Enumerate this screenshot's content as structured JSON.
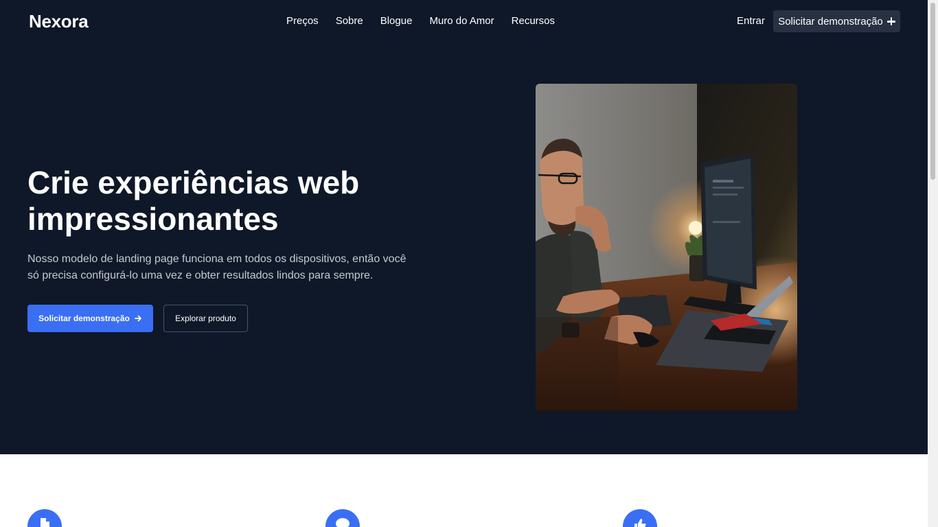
{
  "brand": {
    "logo": "Nexora",
    "accent": "#3a6ff4",
    "hero_bg": "#0f1828"
  },
  "nav": {
    "links": [
      "Preços",
      "Sobre",
      "Blogue",
      "Muro do Amor",
      "Recursos"
    ],
    "signin": "Entrar",
    "cta": {
      "label": "Solicitar demonstração",
      "icon": "plus-icon"
    }
  },
  "hero": {
    "title": "Crie experiências web impressionantes",
    "description": "Nosso modelo de landing page funciona em todos os dispositivos, então você só precisa configurá-lo uma vez e obter resultados lindos para sempre.",
    "primary_button": {
      "label": "Solicitar demonstração",
      "icon": "arrow-right-icon"
    },
    "secondary_button": {
      "label": "Explorar produto"
    }
  },
  "features": [
    {
      "icon": "document-icon"
    },
    {
      "icon": "chat-icon"
    },
    {
      "icon": "thumbs-up-icon"
    }
  ]
}
